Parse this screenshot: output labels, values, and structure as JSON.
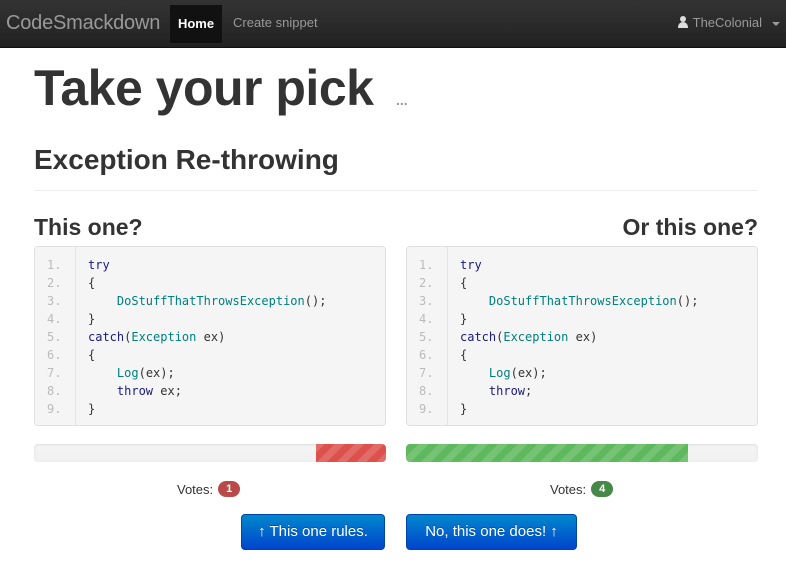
{
  "navbar": {
    "brand": "CodeSmackdown",
    "home": "Home",
    "create": "Create snippet",
    "user": "TheColonial",
    "user_icon": "user-icon",
    "dropdown_icon": "caret-down-icon"
  },
  "page": {
    "title": "Take your pick",
    "ellipsis": "...",
    "section_title": "Exception Re-throwing",
    "left_label": "This one?",
    "right_label": "Or this one?"
  },
  "snippets": {
    "left": {
      "line_numbers": [
        "1.",
        "2.",
        "3.",
        "4.",
        "5.",
        "6.",
        "7.",
        "8.",
        "9."
      ],
      "lines": [
        "try",
        "{",
        "    DoStuffThatThrowsException();",
        "}",
        "catch(Exception ex)",
        "{",
        "    Log(ex);",
        "    throw ex;",
        "}"
      ]
    },
    "right": {
      "line_numbers": [
        "1.",
        "2.",
        "3.",
        "4.",
        "5.",
        "6.",
        "7.",
        "8.",
        "9."
      ],
      "lines": [
        "try",
        "{",
        "    DoStuffThatThrowsException();",
        "}",
        "catch(Exception ex)",
        "{",
        "    Log(ex);",
        "    throw;",
        "}"
      ]
    }
  },
  "votes": {
    "label": "Votes:",
    "left_count": "1",
    "right_count": "4",
    "left_fraction": 0.2,
    "right_fraction": 0.8
  },
  "colors": {
    "left_bar": "#dd514c",
    "right_bar": "#5eb95e",
    "left_badge": "#b94a48",
    "right_badge": "#468847",
    "button": "#0066cc"
  },
  "buttons": {
    "left_label": "This one rules.",
    "right_label": "No, this one does!",
    "arrow_icon": "arrow-up-icon",
    "arrow_glyph": "🡑"
  }
}
